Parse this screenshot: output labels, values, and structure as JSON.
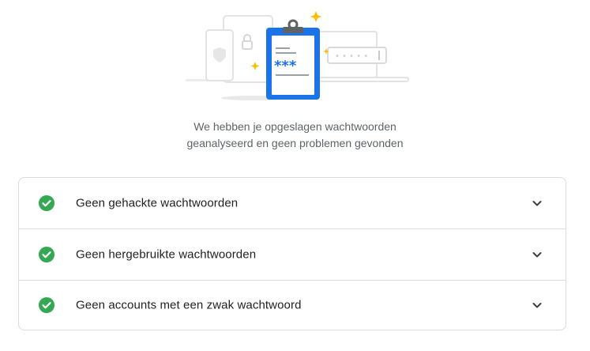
{
  "illustration": {
    "masked_password_stars": "***",
    "masked_field_dots": "• • • • •"
  },
  "summary": {
    "line1": "We hebben je opgeslagen wachtwoorden",
    "line2": "geanalyseerd en geen problemen gevonden"
  },
  "checks": [
    {
      "label": "Geen gehackte wachtwoorden",
      "status": "ok",
      "icon": "check-circle-icon",
      "color": "#34a853"
    },
    {
      "label": "Geen hergebruikte wachtwoorden",
      "status": "ok",
      "icon": "check-circle-icon",
      "color": "#34a853"
    },
    {
      "label": "Geen accounts met een zwak wachtwoord",
      "status": "ok",
      "icon": "check-circle-icon",
      "color": "#34a853"
    }
  ],
  "colors": {
    "accent_blue": "#1a73e8",
    "success_green": "#34a853",
    "sparkle_yellow": "#fbbc04"
  }
}
